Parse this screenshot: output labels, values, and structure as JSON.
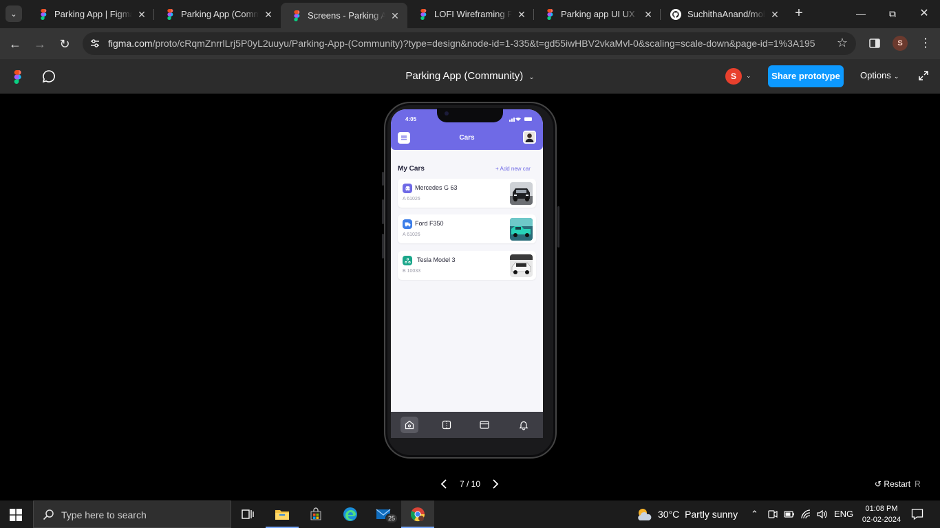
{
  "browser": {
    "tabs": [
      {
        "title": "Parking App | Figma C",
        "active": false
      },
      {
        "title": "Parking App (Commu",
        "active": false
      },
      {
        "title": "Screens - Parking App",
        "active": true
      },
      {
        "title": "LOFI Wireframing Par",
        "active": false
      },
      {
        "title": "Parking app UI UX Kit",
        "active": false
      },
      {
        "title": "SuchithaAnand/mobil",
        "active": false
      }
    ],
    "url_host": "figma.com",
    "url_path": "/proto/cRqmZnrrlLrj5P0yL2uuyu/Parking-App-(Community)?type=design&node-id=1-335&t=gd55iwHBV2vkaMvl-0&scaling=scale-down&page-id=1%3A195",
    "profile_initial": "S"
  },
  "figma": {
    "file_title": "Parking App (Community)",
    "avatar_initial": "S",
    "share_label": "Share prototype",
    "options_label": "Options",
    "pager": "7 / 10",
    "restart_label": "Restart",
    "restart_key": "R"
  },
  "app": {
    "status_time": "4:05",
    "screen_title": "Cars",
    "section_title": "My Cars",
    "add_link": "+ Add new car",
    "cars": [
      {
        "name": "Mercedes G 63",
        "plate": "A 61026",
        "icon_color": "#6f6ae6",
        "icon": "car-icon"
      },
      {
        "name": "Ford F350",
        "plate": "A 61026",
        "icon_color": "#3d7ee8",
        "icon": "truck-icon"
      },
      {
        "name": "Tesla Model 3",
        "plate": "B 10033",
        "icon_color": "#1aa68a",
        "icon": "electric-car-icon"
      }
    ],
    "nav": [
      "home-icon",
      "parking-icon",
      "wallet-icon",
      "bell-icon"
    ]
  },
  "taskbar": {
    "search_placeholder": "Type here to search",
    "mail_badge": "25",
    "weather_temp": "30°C",
    "weather_desc": "Partly sunny",
    "language": "ENG",
    "time": "01:08 PM",
    "date": "02-02-2024"
  }
}
